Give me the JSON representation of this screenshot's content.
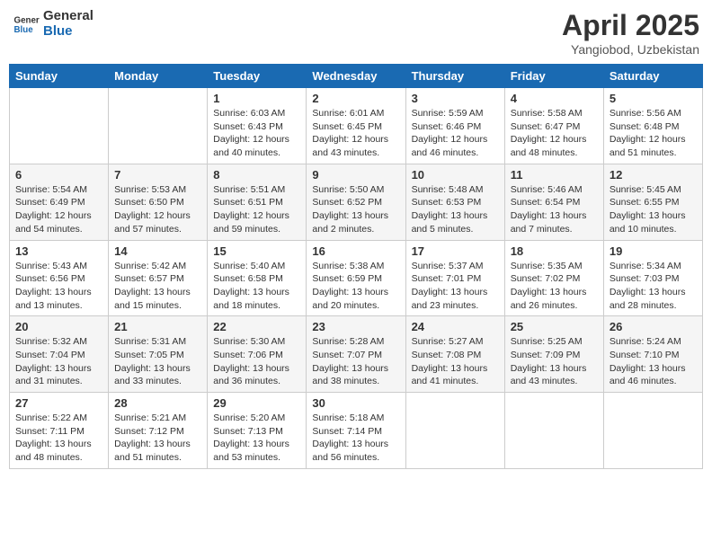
{
  "logo": {
    "line1": "General",
    "line2": "Blue"
  },
  "title": "April 2025",
  "subtitle": "Yangiobod, Uzbekistan",
  "header": {
    "days": [
      "Sunday",
      "Monday",
      "Tuesday",
      "Wednesday",
      "Thursday",
      "Friday",
      "Saturday"
    ]
  },
  "weeks": [
    [
      {
        "num": "",
        "sunrise": "",
        "sunset": "",
        "daylight": ""
      },
      {
        "num": "",
        "sunrise": "",
        "sunset": "",
        "daylight": ""
      },
      {
        "num": "1",
        "sunrise": "Sunrise: 6:03 AM",
        "sunset": "Sunset: 6:43 PM",
        "daylight": "Daylight: 12 hours and 40 minutes."
      },
      {
        "num": "2",
        "sunrise": "Sunrise: 6:01 AM",
        "sunset": "Sunset: 6:45 PM",
        "daylight": "Daylight: 12 hours and 43 minutes."
      },
      {
        "num": "3",
        "sunrise": "Sunrise: 5:59 AM",
        "sunset": "Sunset: 6:46 PM",
        "daylight": "Daylight: 12 hours and 46 minutes."
      },
      {
        "num": "4",
        "sunrise": "Sunrise: 5:58 AM",
        "sunset": "Sunset: 6:47 PM",
        "daylight": "Daylight: 12 hours and 48 minutes."
      },
      {
        "num": "5",
        "sunrise": "Sunrise: 5:56 AM",
        "sunset": "Sunset: 6:48 PM",
        "daylight": "Daylight: 12 hours and 51 minutes."
      }
    ],
    [
      {
        "num": "6",
        "sunrise": "Sunrise: 5:54 AM",
        "sunset": "Sunset: 6:49 PM",
        "daylight": "Daylight: 12 hours and 54 minutes."
      },
      {
        "num": "7",
        "sunrise": "Sunrise: 5:53 AM",
        "sunset": "Sunset: 6:50 PM",
        "daylight": "Daylight: 12 hours and 57 minutes."
      },
      {
        "num": "8",
        "sunrise": "Sunrise: 5:51 AM",
        "sunset": "Sunset: 6:51 PM",
        "daylight": "Daylight: 12 hours and 59 minutes."
      },
      {
        "num": "9",
        "sunrise": "Sunrise: 5:50 AM",
        "sunset": "Sunset: 6:52 PM",
        "daylight": "Daylight: 13 hours and 2 minutes."
      },
      {
        "num": "10",
        "sunrise": "Sunrise: 5:48 AM",
        "sunset": "Sunset: 6:53 PM",
        "daylight": "Daylight: 13 hours and 5 minutes."
      },
      {
        "num": "11",
        "sunrise": "Sunrise: 5:46 AM",
        "sunset": "Sunset: 6:54 PM",
        "daylight": "Daylight: 13 hours and 7 minutes."
      },
      {
        "num": "12",
        "sunrise": "Sunrise: 5:45 AM",
        "sunset": "Sunset: 6:55 PM",
        "daylight": "Daylight: 13 hours and 10 minutes."
      }
    ],
    [
      {
        "num": "13",
        "sunrise": "Sunrise: 5:43 AM",
        "sunset": "Sunset: 6:56 PM",
        "daylight": "Daylight: 13 hours and 13 minutes."
      },
      {
        "num": "14",
        "sunrise": "Sunrise: 5:42 AM",
        "sunset": "Sunset: 6:57 PM",
        "daylight": "Daylight: 13 hours and 15 minutes."
      },
      {
        "num": "15",
        "sunrise": "Sunrise: 5:40 AM",
        "sunset": "Sunset: 6:58 PM",
        "daylight": "Daylight: 13 hours and 18 minutes."
      },
      {
        "num": "16",
        "sunrise": "Sunrise: 5:38 AM",
        "sunset": "Sunset: 6:59 PM",
        "daylight": "Daylight: 13 hours and 20 minutes."
      },
      {
        "num": "17",
        "sunrise": "Sunrise: 5:37 AM",
        "sunset": "Sunset: 7:01 PM",
        "daylight": "Daylight: 13 hours and 23 minutes."
      },
      {
        "num": "18",
        "sunrise": "Sunrise: 5:35 AM",
        "sunset": "Sunset: 7:02 PM",
        "daylight": "Daylight: 13 hours and 26 minutes."
      },
      {
        "num": "19",
        "sunrise": "Sunrise: 5:34 AM",
        "sunset": "Sunset: 7:03 PM",
        "daylight": "Daylight: 13 hours and 28 minutes."
      }
    ],
    [
      {
        "num": "20",
        "sunrise": "Sunrise: 5:32 AM",
        "sunset": "Sunset: 7:04 PM",
        "daylight": "Daylight: 13 hours and 31 minutes."
      },
      {
        "num": "21",
        "sunrise": "Sunrise: 5:31 AM",
        "sunset": "Sunset: 7:05 PM",
        "daylight": "Daylight: 13 hours and 33 minutes."
      },
      {
        "num": "22",
        "sunrise": "Sunrise: 5:30 AM",
        "sunset": "Sunset: 7:06 PM",
        "daylight": "Daylight: 13 hours and 36 minutes."
      },
      {
        "num": "23",
        "sunrise": "Sunrise: 5:28 AM",
        "sunset": "Sunset: 7:07 PM",
        "daylight": "Daylight: 13 hours and 38 minutes."
      },
      {
        "num": "24",
        "sunrise": "Sunrise: 5:27 AM",
        "sunset": "Sunset: 7:08 PM",
        "daylight": "Daylight: 13 hours and 41 minutes."
      },
      {
        "num": "25",
        "sunrise": "Sunrise: 5:25 AM",
        "sunset": "Sunset: 7:09 PM",
        "daylight": "Daylight: 13 hours and 43 minutes."
      },
      {
        "num": "26",
        "sunrise": "Sunrise: 5:24 AM",
        "sunset": "Sunset: 7:10 PM",
        "daylight": "Daylight: 13 hours and 46 minutes."
      }
    ],
    [
      {
        "num": "27",
        "sunrise": "Sunrise: 5:22 AM",
        "sunset": "Sunset: 7:11 PM",
        "daylight": "Daylight: 13 hours and 48 minutes."
      },
      {
        "num": "28",
        "sunrise": "Sunrise: 5:21 AM",
        "sunset": "Sunset: 7:12 PM",
        "daylight": "Daylight: 13 hours and 51 minutes."
      },
      {
        "num": "29",
        "sunrise": "Sunrise: 5:20 AM",
        "sunset": "Sunset: 7:13 PM",
        "daylight": "Daylight: 13 hours and 53 minutes."
      },
      {
        "num": "30",
        "sunrise": "Sunrise: 5:18 AM",
        "sunset": "Sunset: 7:14 PM",
        "daylight": "Daylight: 13 hours and 56 minutes."
      },
      {
        "num": "",
        "sunrise": "",
        "sunset": "",
        "daylight": ""
      },
      {
        "num": "",
        "sunrise": "",
        "sunset": "",
        "daylight": ""
      },
      {
        "num": "",
        "sunrise": "",
        "sunset": "",
        "daylight": ""
      }
    ]
  ]
}
